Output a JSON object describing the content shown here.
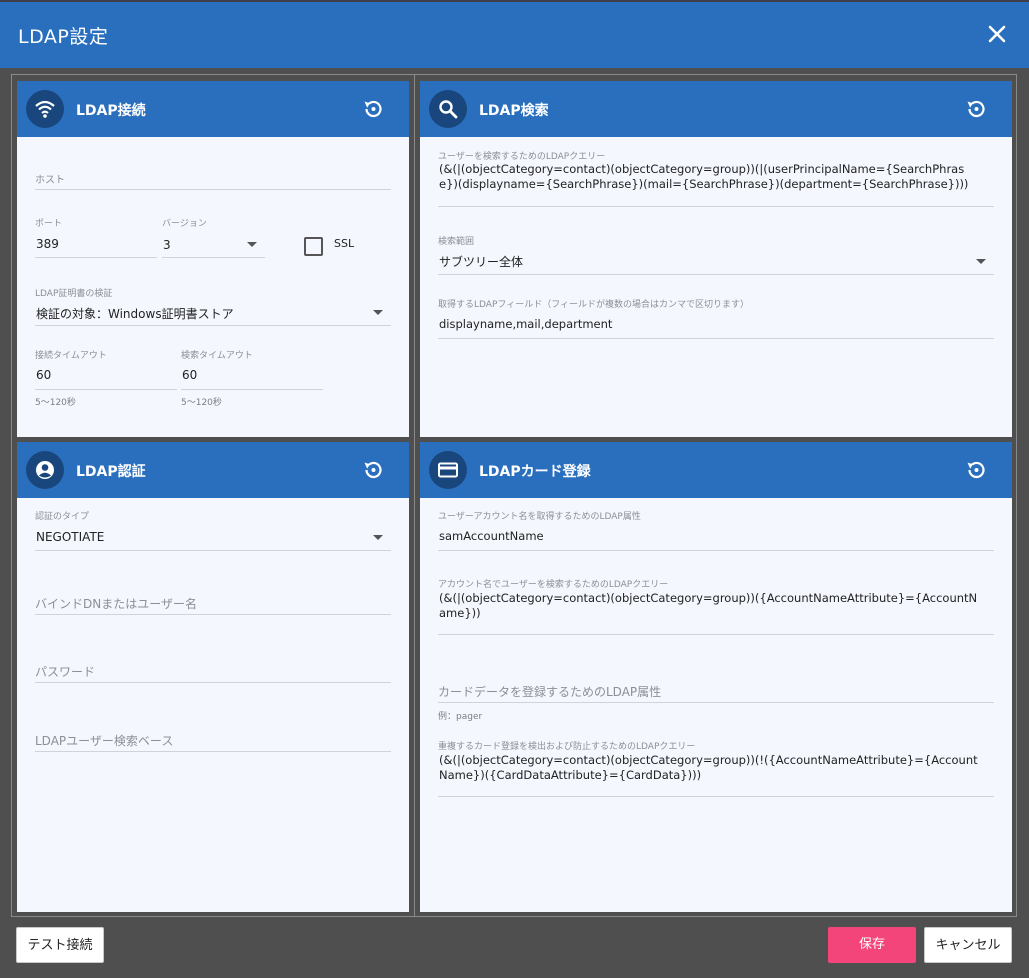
{
  "dialog": {
    "title": "LDAP設定"
  },
  "connection": {
    "title": "LDAP接続",
    "host": {
      "placeholder": "ホスト"
    },
    "port": {
      "label": "ポート",
      "value": "389"
    },
    "version": {
      "label": "バージョン",
      "value": "3"
    },
    "ssl_label": "SSL",
    "cert": {
      "label": "LDAP証明書の検証",
      "value": "検証の対象：Windows証明書ストア"
    },
    "conn_timeout": {
      "label": "接続タイムアウト",
      "value": "60",
      "hint": "5～120秒"
    },
    "search_timeout": {
      "label": "検索タイムアウト",
      "value": "60",
      "hint": "5～120秒"
    }
  },
  "search": {
    "title": "LDAP検索",
    "query": {
      "label": "ユーザーを検索するためのLDAPクエリー",
      "value": "(&(|(objectCategory=contact)(objectCategory=group))(|(userPrincipalName={SearchPhrase})(displayname={SearchPhrase})(mail={SearchPhrase})(department={SearchPhrase})))"
    },
    "scope": {
      "label": "検索範囲",
      "value": "サブツリー全体"
    },
    "fields": {
      "label": "取得するLDAPフィールド（フィールドが複数の場合はカンマで区切ります）",
      "value": "displayname,mail,department"
    }
  },
  "auth": {
    "title": "LDAP認証",
    "type": {
      "label": "認証のタイプ",
      "value": "NEGOTIATE"
    },
    "bind_dn": {
      "placeholder": "バインドDNまたはユーザー名"
    },
    "password": {
      "placeholder": "パスワード"
    },
    "base": {
      "placeholder": "LDAPユーザー検索ベース"
    }
  },
  "card": {
    "title": "LDAPカード登録",
    "account_attr": {
      "label": "ユーザーアカウント名を取得するためのLDAP属性",
      "value": "samAccountName"
    },
    "account_query": {
      "label": "アカウント名でユーザーを検索するためのLDAPクエリー",
      "value": "(&(|(objectCategory=contact)(objectCategory=group))({AccountNameAttribute}={AccountName}))"
    },
    "card_attr": {
      "placeholder": "カードデータを登録するためのLDAP属性",
      "hint": "例：pager"
    },
    "dup_query": {
      "label": "重複するカード登録を検出および防止するためのLDAPクエリー",
      "value": "(&(|(objectCategory=contact)(objectCategory=group))(!({AccountNameAttribute}={AccountName})({CardDataAttribute}={CardData})))"
    }
  },
  "buttons": {
    "test": "テスト接続",
    "save": "保存",
    "cancel": "キャンセル"
  },
  "colors": {
    "header": "#2a6fbd",
    "badge": "#19467d",
    "save": "#f3457a",
    "card_bg": "#f4f7fe"
  }
}
